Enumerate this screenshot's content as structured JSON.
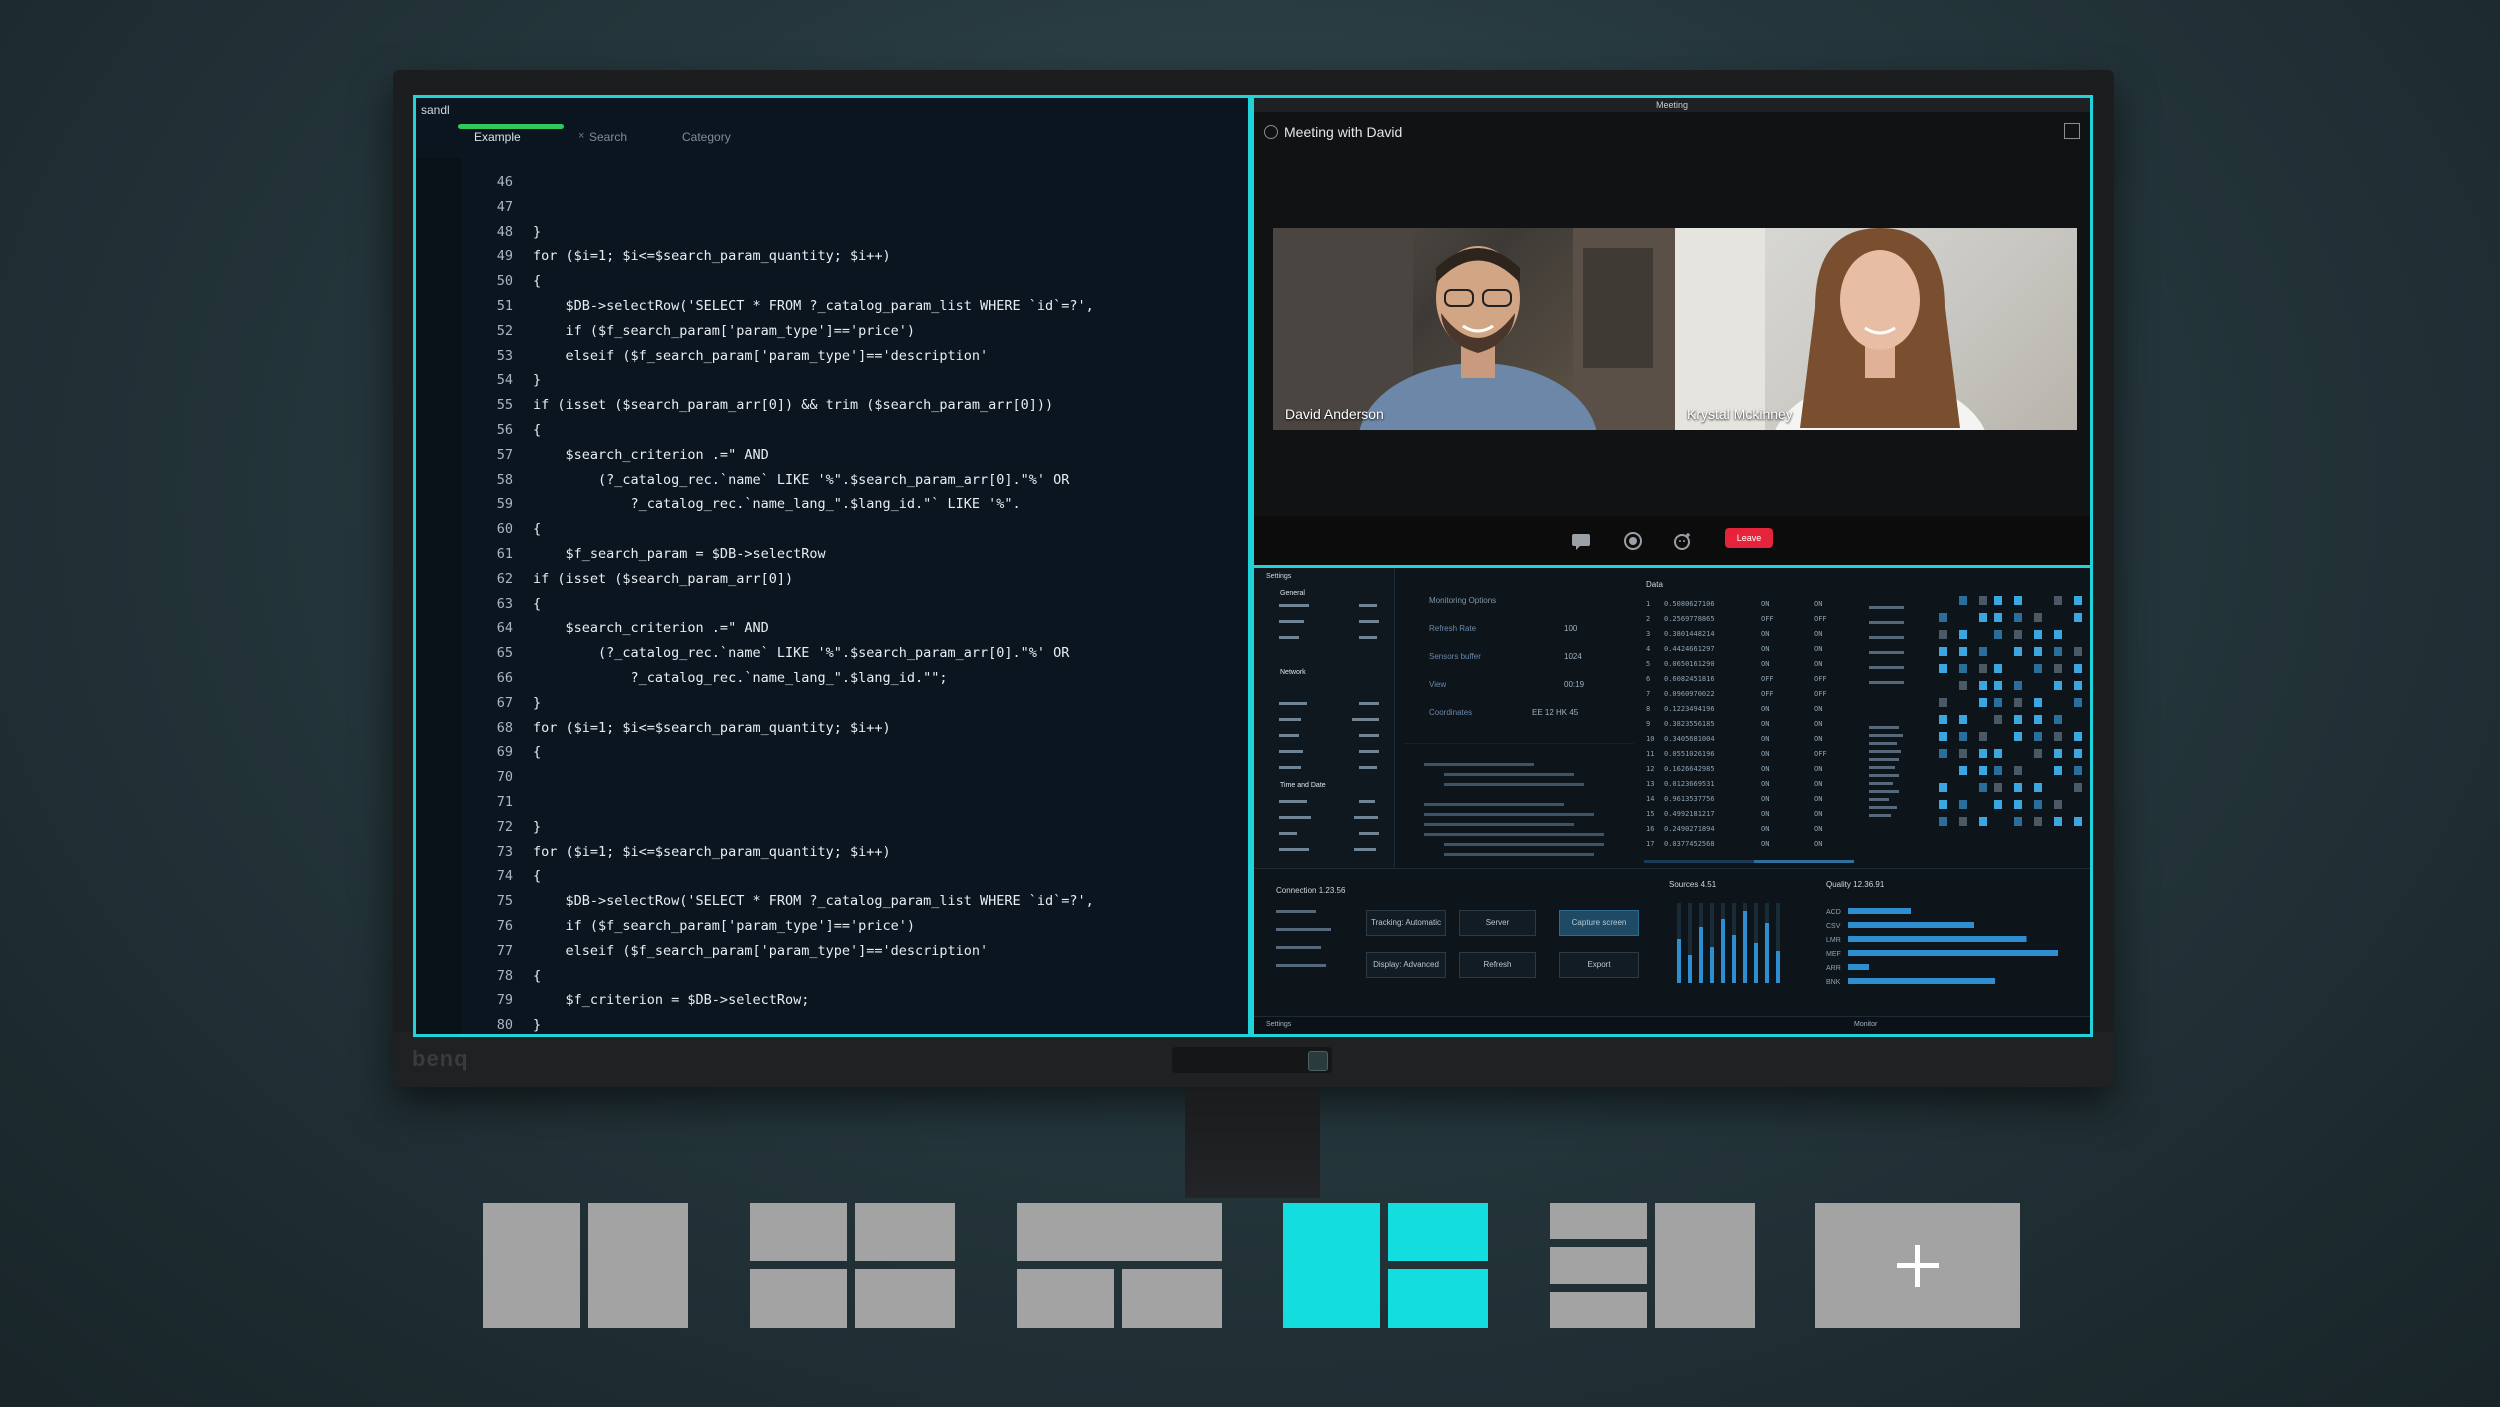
{
  "code_window": {
    "title": "sandl",
    "tabs": [
      {
        "label": "Example",
        "active": true
      },
      {
        "label": "Search",
        "active": false
      },
      {
        "label": "Category",
        "active": false
      }
    ],
    "tab_close": "×",
    "lines": [
      {
        "n": "46",
        "code": ""
      },
      {
        "n": "47",
        "code": ""
      },
      {
        "n": "48",
        "code": "}"
      },
      {
        "n": "49",
        "code": "for ($i=1; $i<=$search_param_quantity; $i++)"
      },
      {
        "n": "50",
        "code": "{"
      },
      {
        "n": "51",
        "code": "    $DB->selectRow('SELECT * FROM ?_catalog_param_list WHERE `id`=?',"
      },
      {
        "n": "52",
        "code": "    if ($f_search_param['param_type']=='price')"
      },
      {
        "n": "53",
        "code": "    elseif ($f_search_param['param_type']=='description'"
      },
      {
        "n": "54",
        "code": "}"
      },
      {
        "n": "55",
        "code": "if (isset ($search_param_arr[0]) && trim ($search_param_arr[0]))"
      },
      {
        "n": "56",
        "code": "{"
      },
      {
        "n": "57",
        "code": "    $search_criterion .=\" AND"
      },
      {
        "n": "58",
        "code": "        (?_catalog_rec.`name` LIKE '%\".$search_param_arr[0].\"%' OR"
      },
      {
        "n": "59",
        "code": "            ?_catalog_rec.`name_lang_\".$lang_id.\"` LIKE '%\"."
      },
      {
        "n": "60",
        "code": "{"
      },
      {
        "n": "61",
        "code": "    $f_search_param = $DB->selectRow"
      },
      {
        "n": "62",
        "code": "if (isset ($search_param_arr[0])"
      },
      {
        "n": "63",
        "code": "{"
      },
      {
        "n": "64",
        "code": "    $search_criterion .=\" AND"
      },
      {
        "n": "65",
        "code": "        (?_catalog_rec.`name` LIKE '%\".$search_param_arr[0].\"%' OR"
      },
      {
        "n": "66",
        "code": "            ?_catalog_rec.`name_lang_\".$lang_id.\"\";"
      },
      {
        "n": "67",
        "code": "}"
      },
      {
        "n": "68",
        "code": "for ($i=1; $i<=$search_param_quantity; $i++)"
      },
      {
        "n": "69",
        "code": "{"
      },
      {
        "n": "70",
        "code": ""
      },
      {
        "n": "71",
        "code": ""
      },
      {
        "n": "72",
        "code": "}"
      },
      {
        "n": "73",
        "code": "for ($i=1; $i<=$search_param_quantity; $i++)"
      },
      {
        "n": "74",
        "code": "{"
      },
      {
        "n": "75",
        "code": "    $DB->selectRow('SELECT * FROM ?_catalog_param_list WHERE `id`=?',"
      },
      {
        "n": "76",
        "code": "    if ($f_search_param['param_type']=='price')"
      },
      {
        "n": "77",
        "code": "    elseif ($f_search_param['param_type']=='description'"
      },
      {
        "n": "78",
        "code": "{"
      },
      {
        "n": "79",
        "code": "    $f_criterion = $DB->selectRow;"
      },
      {
        "n": "80",
        "code": "}"
      }
    ]
  },
  "meeting": {
    "window_title": "Meeting",
    "title": "Meeting with David",
    "participants": [
      {
        "name": "David Anderson"
      },
      {
        "name": "Krystal Mckinney"
      }
    ],
    "leave_label": "Leave"
  },
  "dashboard": {
    "settings_label": "Settings",
    "general": "General",
    "network": "Network",
    "time_date": "Time and Date",
    "monitoring_title": "Monitoring Options",
    "refresh_rate_label": "Refresh Rate",
    "refresh_rate_value": "100",
    "sensors_buffer_label": "Sensors buffer",
    "sensors_buffer_value": "1024",
    "view_label": "View",
    "view_value": "00:19",
    "coordinates_label": "Coordinates",
    "coordinates_value": "EE 12 HK 45",
    "data_label": "Data",
    "connection_label": "Connection 1.23.56",
    "sources_label": "Sources 4.51",
    "quality_label": "Quality 12.36.91",
    "buttons": {
      "tracking": "Tracking: Automatic",
      "server": "Server",
      "capture": "Capture screen",
      "display": "Display: Advanced",
      "refresh": "Refresh",
      "export": "Export"
    },
    "data_rows": [
      {
        "n": "1",
        "v": "0.5080627106",
        "a": "ON",
        "b": "ON"
      },
      {
        "n": "2",
        "v": "0.2569778865",
        "a": "OFF",
        "b": "OFF"
      },
      {
        "n": "3",
        "v": "0.3801448214",
        "a": "ON",
        "b": "ON"
      },
      {
        "n": "4",
        "v": "0.4424661297",
        "a": "ON",
        "b": "ON"
      },
      {
        "n": "5",
        "v": "0.0650161290",
        "a": "ON",
        "b": "ON"
      },
      {
        "n": "6",
        "v": "0.6082451816",
        "a": "OFF",
        "b": "OFF"
      },
      {
        "n": "7",
        "v": "0.0960970022",
        "a": "OFF",
        "b": "OFF"
      },
      {
        "n": "8",
        "v": "0.1223494196",
        "a": "ON",
        "b": "ON"
      },
      {
        "n": "9",
        "v": "0.3823556185",
        "a": "ON",
        "b": "ON"
      },
      {
        "n": "10",
        "v": "0.3405681004",
        "a": "ON",
        "b": "ON"
      },
      {
        "n": "11",
        "v": "0.0551026196",
        "a": "ON",
        "b": "OFF"
      },
      {
        "n": "12",
        "v": "0.1626642985",
        "a": "ON",
        "b": "ON"
      },
      {
        "n": "13",
        "v": "0.0123669531",
        "a": "ON",
        "b": "ON"
      },
      {
        "n": "14",
        "v": "0.9613537756",
        "a": "ON",
        "b": "ON"
      },
      {
        "n": "15",
        "v": "0.4992181217",
        "a": "ON",
        "b": "ON"
      },
      {
        "n": "16",
        "v": "0.2490271894",
        "a": "ON",
        "b": "ON"
      },
      {
        "n": "17",
        "v": "0.0377452568",
        "a": "ON",
        "b": "ON"
      }
    ],
    "quality_bars": [
      {
        "label": "ACD",
        "value": 0.3
      },
      {
        "label": "CSV",
        "value": 0.6
      },
      {
        "label": "LMR",
        "value": 0.85
      },
      {
        "label": "MEF",
        "value": 1.0
      },
      {
        "label": "ARR",
        "value": 0.1
      },
      {
        "label": "BNK",
        "value": 0.7
      }
    ],
    "slider_levels": [
      0.55,
      0.35,
      0.7,
      0.45,
      0.8,
      0.6,
      0.9,
      0.5,
      0.75,
      0.4
    ],
    "monitor_label": "Monitor"
  },
  "monitor": {
    "brand": "benq"
  },
  "layouts": [
    {
      "name": "layout-two-columns",
      "active": false
    },
    {
      "name": "layout-four-grid",
      "active": false
    },
    {
      "name": "layout-top-wide-two-bottom",
      "active": false
    },
    {
      "name": "layout-left-tall-right-split",
      "active": true
    },
    {
      "name": "layout-three-rows-left-tall-right",
      "active": false
    },
    {
      "name": "layout-add-custom",
      "active": false
    }
  ],
  "colors": {
    "accent": "#1fd3d9",
    "leave": "#e5233a",
    "layout_inactive": "#a3a3a3",
    "layout_active": "#14dde0"
  }
}
